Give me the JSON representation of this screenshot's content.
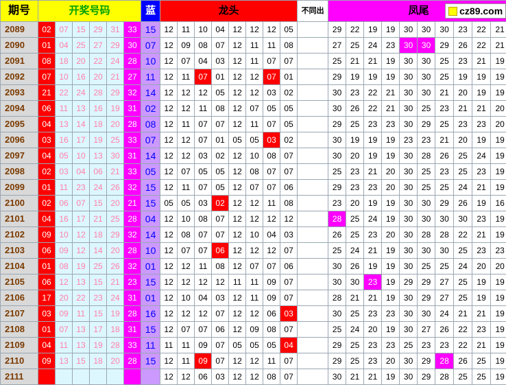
{
  "header": {
    "period": "期号",
    "draw": "开奖号码",
    "blue": "蓝",
    "dragon_head": "龙头",
    "not_repeat": "不同出",
    "phoenix_tail": "凤尾",
    "logo": "cz89.com"
  },
  "colors": {
    "yellow": "#ffff00",
    "red": "#ff0000",
    "magenta": "#ff00ff",
    "lavender": "#cc99ff",
    "blue": "#0000ff",
    "light_cyan": "#ddf7ff",
    "period_gray": "#d9d9d9"
  },
  "rows": [
    {
      "period": "2089",
      "reds": [
        "02",
        "07",
        "15",
        "29",
        "31",
        "33"
      ],
      "blue": "15",
      "dragon": [
        "12",
        "11",
        "10",
        "04",
        "12",
        "12",
        "12",
        "05"
      ],
      "dragon_hl": [],
      "phoenix": [
        "29",
        "22",
        "19",
        "19",
        "30",
        "30",
        "30",
        "23",
        "22",
        "21"
      ],
      "phoenix_hl": []
    },
    {
      "period": "2090",
      "reds": [
        "01",
        "04",
        "25",
        "27",
        "29",
        "30"
      ],
      "blue": "07",
      "dragon": [
        "12",
        "09",
        "08",
        "07",
        "12",
        "11",
        "11",
        "08"
      ],
      "dragon_hl": [],
      "phoenix": [
        "27",
        "25",
        "24",
        "23",
        "30",
        "30",
        "29",
        "26",
        "22",
        "21"
      ],
      "phoenix_hl": [
        4,
        5
      ]
    },
    {
      "period": "2091",
      "reds": [
        "08",
        "18",
        "20",
        "22",
        "24",
        "28"
      ],
      "blue": "10",
      "dragon": [
        "12",
        "07",
        "04",
        "03",
        "12",
        "11",
        "07",
        "07"
      ],
      "dragon_hl": [],
      "phoenix": [
        "25",
        "21",
        "21",
        "19",
        "30",
        "30",
        "25",
        "23",
        "21",
        "19"
      ],
      "phoenix_hl": []
    },
    {
      "period": "2092",
      "reds": [
        "07",
        "10",
        "16",
        "20",
        "21",
        "27"
      ],
      "blue": "11",
      "dragon": [
        "12",
        "11",
        "07",
        "01",
        "12",
        "12",
        "07",
        "01"
      ],
      "dragon_hl": [
        2,
        6
      ],
      "phoenix": [
        "29",
        "19",
        "19",
        "19",
        "30",
        "30",
        "25",
        "19",
        "19",
        "19"
      ],
      "phoenix_hl": []
    },
    {
      "period": "2093",
      "reds": [
        "21",
        "22",
        "24",
        "28",
        "29",
        "32"
      ],
      "blue": "14",
      "dragon": [
        "12",
        "12",
        "12",
        "05",
        "12",
        "12",
        "03",
        "02"
      ],
      "dragon_hl": [],
      "phoenix": [
        "30",
        "23",
        "22",
        "21",
        "30",
        "30",
        "21",
        "20",
        "19",
        "19"
      ],
      "phoenix_hl": []
    },
    {
      "period": "2094",
      "reds": [
        "06",
        "11",
        "13",
        "16",
        "19",
        "31"
      ],
      "blue": "02",
      "dragon": [
        "12",
        "12",
        "11",
        "08",
        "12",
        "07",
        "05",
        "05"
      ],
      "dragon_hl": [],
      "phoenix": [
        "30",
        "26",
        "22",
        "21",
        "30",
        "25",
        "23",
        "21",
        "21",
        "20"
      ],
      "phoenix_hl": []
    },
    {
      "period": "2095",
      "reds": [
        "04",
        "13",
        "14",
        "18",
        "20",
        "28"
      ],
      "blue": "08",
      "dragon": [
        "12",
        "11",
        "07",
        "07",
        "12",
        "11",
        "07",
        "05"
      ],
      "dragon_hl": [],
      "phoenix": [
        "29",
        "25",
        "23",
        "23",
        "30",
        "29",
        "25",
        "23",
        "23",
        "20"
      ],
      "phoenix_hl": []
    },
    {
      "period": "2096",
      "reds": [
        "03",
        "16",
        "17",
        "19",
        "25",
        "33"
      ],
      "blue": "07",
      "dragon": [
        "12",
        "12",
        "07",
        "01",
        "05",
        "05",
        "03",
        "02"
      ],
      "dragon_hl": [
        6
      ],
      "phoenix": [
        "30",
        "19",
        "19",
        "19",
        "23",
        "23",
        "21",
        "20",
        "19",
        "19"
      ],
      "phoenix_hl": []
    },
    {
      "period": "2097",
      "reds": [
        "04",
        "05",
        "10",
        "13",
        "30",
        "31"
      ],
      "blue": "14",
      "dragon": [
        "12",
        "12",
        "03",
        "02",
        "12",
        "10",
        "08",
        "07"
      ],
      "dragon_hl": [],
      "phoenix": [
        "30",
        "20",
        "19",
        "19",
        "30",
        "28",
        "26",
        "25",
        "24",
        "19"
      ],
      "phoenix_hl": []
    },
    {
      "period": "2098",
      "reds": [
        "02",
        "03",
        "04",
        "06",
        "21",
        "33"
      ],
      "blue": "05",
      "dragon": [
        "12",
        "07",
        "05",
        "05",
        "12",
        "08",
        "07",
        "07"
      ],
      "dragon_hl": [],
      "phoenix": [
        "25",
        "23",
        "21",
        "20",
        "30",
        "25",
        "23",
        "25",
        "23",
        "19"
      ],
      "phoenix_hl": []
    },
    {
      "period": "2099",
      "reds": [
        "01",
        "11",
        "23",
        "24",
        "26",
        "32"
      ],
      "blue": "15",
      "dragon": [
        "12",
        "11",
        "07",
        "05",
        "12",
        "07",
        "07",
        "06"
      ],
      "dragon_hl": [],
      "phoenix": [
        "29",
        "23",
        "23",
        "20",
        "30",
        "25",
        "25",
        "24",
        "21",
        "19"
      ],
      "phoenix_hl": []
    },
    {
      "period": "2100",
      "reds": [
        "02",
        "06",
        "07",
        "15",
        "20",
        "21"
      ],
      "blue": "15",
      "dragon": [
        "05",
        "05",
        "03",
        "02",
        "12",
        "12",
        "11",
        "08"
      ],
      "dragon_hl": [
        3
      ],
      "phoenix": [
        "23",
        "20",
        "19",
        "19",
        "30",
        "30",
        "29",
        "26",
        "19",
        "16"
      ],
      "phoenix_hl": []
    },
    {
      "period": "2101",
      "reds": [
        "04",
        "16",
        "17",
        "21",
        "25",
        "28"
      ],
      "blue": "04",
      "dragon": [
        "12",
        "10",
        "08",
        "07",
        "12",
        "12",
        "12",
        "12"
      ],
      "dragon_hl": [],
      "phoenix": [
        "28",
        "25",
        "24",
        "19",
        "30",
        "30",
        "30",
        "30",
        "23",
        "19"
      ],
      "phoenix_hl": [
        0
      ]
    },
    {
      "period": "2102",
      "reds": [
        "09",
        "10",
        "12",
        "18",
        "29",
        "32"
      ],
      "blue": "14",
      "dragon": [
        "12",
        "08",
        "07",
        "07",
        "12",
        "10",
        "04",
        "03"
      ],
      "dragon_hl": [],
      "phoenix": [
        "26",
        "25",
        "23",
        "20",
        "30",
        "28",
        "28",
        "22",
        "21",
        "19"
      ],
      "phoenix_hl": []
    },
    {
      "period": "2103",
      "reds": [
        "06",
        "09",
        "12",
        "14",
        "20",
        "28"
      ],
      "blue": "10",
      "dragon": [
        "12",
        "07",
        "07",
        "06",
        "12",
        "12",
        "12",
        "07"
      ],
      "dragon_hl": [
        3
      ],
      "phoenix": [
        "25",
        "24",
        "21",
        "19",
        "30",
        "30",
        "30",
        "25",
        "23",
        "23"
      ],
      "phoenix_hl": []
    },
    {
      "period": "2104",
      "reds": [
        "01",
        "08",
        "19",
        "25",
        "26",
        "32"
      ],
      "blue": "01",
      "dragon": [
        "12",
        "12",
        "11",
        "08",
        "12",
        "07",
        "07",
        "06"
      ],
      "dragon_hl": [],
      "phoenix": [
        "30",
        "26",
        "19",
        "19",
        "30",
        "25",
        "25",
        "24",
        "20",
        "20"
      ],
      "phoenix_hl": []
    },
    {
      "period": "2105",
      "reds": [
        "06",
        "12",
        "13",
        "15",
        "21",
        "23"
      ],
      "blue": "15",
      "dragon": [
        "12",
        "12",
        "12",
        "12",
        "11",
        "11",
        "09",
        "07"
      ],
      "dragon_hl": [],
      "phoenix": [
        "30",
        "30",
        "23",
        "19",
        "29",
        "29",
        "27",
        "25",
        "19",
        "19"
      ],
      "phoenix_hl": [
        2
      ]
    },
    {
      "period": "2106",
      "reds": [
        "17",
        "20",
        "22",
        "23",
        "24",
        "31"
      ],
      "blue": "01",
      "dragon": [
        "12",
        "10",
        "04",
        "03",
        "12",
        "11",
        "09",
        "07"
      ],
      "dragon_hl": [],
      "phoenix": [
        "28",
        "21",
        "21",
        "19",
        "30",
        "29",
        "27",
        "25",
        "19",
        "19"
      ],
      "phoenix_hl": []
    },
    {
      "period": "2107",
      "reds": [
        "03",
        "09",
        "11",
        "15",
        "19",
        "28"
      ],
      "blue": "16",
      "dragon": [
        "12",
        "12",
        "12",
        "07",
        "12",
        "12",
        "06",
        "03"
      ],
      "dragon_hl": [
        7
      ],
      "phoenix": [
        "30",
        "25",
        "23",
        "23",
        "30",
        "30",
        "24",
        "21",
        "21",
        "19"
      ],
      "phoenix_hl": []
    },
    {
      "period": "2108",
      "reds": [
        "01",
        "07",
        "13",
        "17",
        "18",
        "31"
      ],
      "blue": "15",
      "dragon": [
        "12",
        "07",
        "07",
        "06",
        "12",
        "09",
        "08",
        "07"
      ],
      "dragon_hl": [],
      "phoenix": [
        "25",
        "24",
        "20",
        "19",
        "30",
        "27",
        "26",
        "22",
        "23",
        "19"
      ],
      "phoenix_hl": []
    },
    {
      "period": "2109",
      "reds": [
        "04",
        "11",
        "13",
        "19",
        "28",
        "33"
      ],
      "blue": "11",
      "dragon": [
        "11",
        "11",
        "09",
        "07",
        "05",
        "05",
        "05",
        "04"
      ],
      "dragon_hl": [
        7
      ],
      "phoenix": [
        "29",
        "25",
        "23",
        "23",
        "25",
        "23",
        "23",
        "22",
        "21",
        "19"
      ],
      "phoenix_hl": []
    },
    {
      "period": "2110",
      "reds": [
        "09",
        "13",
        "15",
        "18",
        "20",
        "28"
      ],
      "blue": "15",
      "dragon": [
        "12",
        "11",
        "09",
        "07",
        "12",
        "12",
        "11",
        "07"
      ],
      "dragon_hl": [
        2
      ],
      "phoenix": [
        "29",
        "25",
        "23",
        "20",
        "30",
        "29",
        "28",
        "26",
        "25",
        "19"
      ],
      "phoenix_hl": [
        6
      ]
    },
    {
      "period": "2111",
      "reds": [
        "",
        "",
        "",
        "",
        "",
        ""
      ],
      "blue": "",
      "dragon": [
        "12",
        "12",
        "06",
        "03",
        "12",
        "12",
        "08",
        "07"
      ],
      "dragon_hl": [],
      "phoenix": [
        "30",
        "21",
        "21",
        "19",
        "30",
        "29",
        "28",
        "25",
        "25",
        "19"
      ],
      "phoenix_hl": []
    }
  ]
}
